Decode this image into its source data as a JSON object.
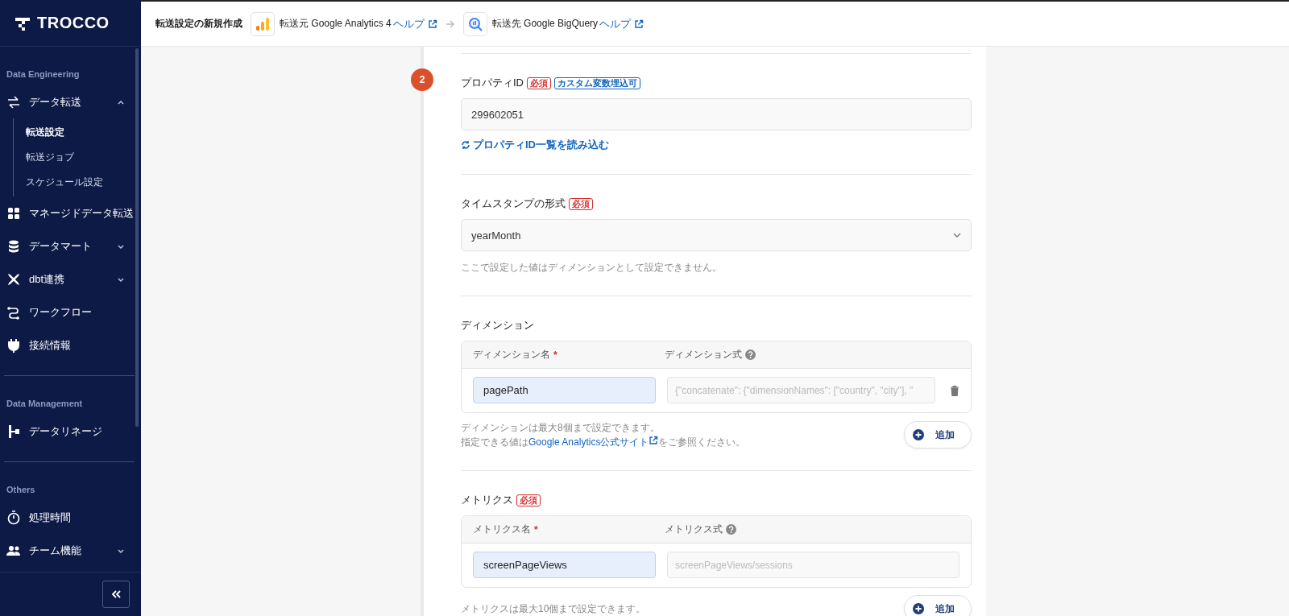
{
  "sidebar": {
    "logo": "TROCCO",
    "sections": [
      {
        "title": "Data Engineering",
        "items": [
          {
            "label": "データ転送",
            "expanded": true,
            "children": [
              {
                "label": "転送設定",
                "selected": true
              },
              {
                "label": "転送ジョブ",
                "selected": false
              },
              {
                "label": "スケジュール設定",
                "selected": false
              }
            ]
          },
          {
            "label": "マネージドデータ転送"
          },
          {
            "label": "データマート",
            "expanded": false
          },
          {
            "label": "dbt連携",
            "expanded": false
          },
          {
            "label": "ワークフロー"
          },
          {
            "label": "接続情報"
          }
        ]
      },
      {
        "title": "Data Management",
        "items": [
          {
            "label": "データリネージ"
          }
        ]
      },
      {
        "title": "Others",
        "items": [
          {
            "label": "処理時間"
          },
          {
            "label": "チーム機能",
            "expanded": false
          }
        ]
      }
    ]
  },
  "header": {
    "title": "転送設定の新規作成",
    "source": {
      "label": "転送元 Google Analytics 4",
      "help": "ヘルプ"
    },
    "destination": {
      "label": "転送先 Google BigQuery",
      "help": "ヘルプ"
    }
  },
  "form": {
    "step": "2",
    "sections": [
      {
        "kind": "input",
        "label": "プロパティID",
        "badges": [
          {
            "text": "必須",
            "kind": "required"
          },
          {
            "text": "カスタム変数埋込可",
            "kind": "info"
          }
        ],
        "value": "299602051",
        "link": "プロパティID一覧を読み込む"
      },
      {
        "kind": "select",
        "label": "タイムスタンプの形式",
        "badges": [
          {
            "text": "必須",
            "kind": "required"
          }
        ],
        "value": "yearMonth",
        "help": "ここで設定した値はディメンションとして設定できません。"
      },
      {
        "kind": "table",
        "label": "ディメンション",
        "columns": [
          {
            "label": "ディメンション名",
            "mark": "*",
            "help_icon": false
          },
          {
            "label": "ディメンション式",
            "help_icon": true
          }
        ],
        "rows": [
          {
            "name": "pagePath",
            "placeholder": "{\"concatenate\": {\"dimensionNames\": [\"country\", \"city\"], \"",
            "deletable": true
          }
        ],
        "help": "ディメンションは最大8個まで設定できます。",
        "help_line": {
          "before": "指定できる値は",
          "link": "Google Analytics公式サイト",
          "after": "をご参照ください。"
        },
        "add_button": "追加"
      },
      {
        "kind": "table",
        "label": "メトリクス",
        "badges": [
          {
            "text": "必須",
            "kind": "required"
          }
        ],
        "columns": [
          {
            "label": "メトリクス名",
            "mark": "*",
            "help_icon": false
          },
          {
            "label": "メトリクス式",
            "help_icon": true
          }
        ],
        "rows": [
          {
            "name": "screenPageViews",
            "placeholder": "screenPageViews/sessions",
            "deletable": false
          }
        ],
        "help": "メトリクスは最大10個まで設定できます。",
        "add_button": "追加"
      }
    ]
  }
}
